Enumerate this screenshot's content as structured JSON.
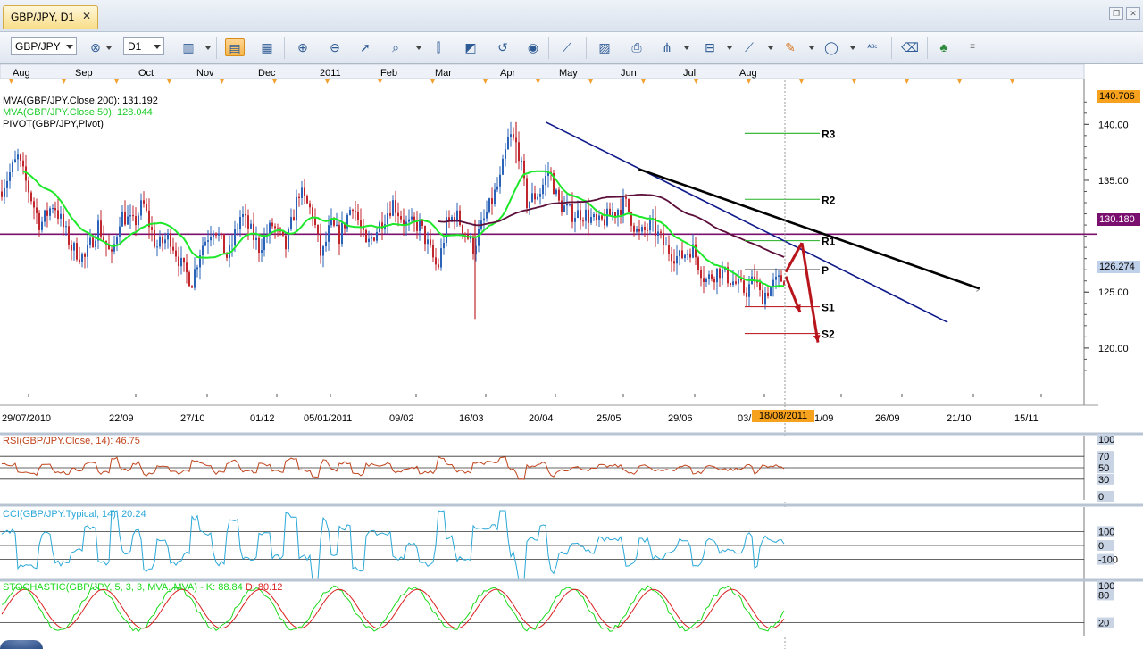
{
  "window": {
    "tab_label": "GBP/JPY, D1",
    "close_glyph": "✕",
    "restore_glyph": "❐",
    "close_window_glyph": "✕"
  },
  "toolbar": {
    "symbol": "GBP/JPY",
    "timeframe": "D1",
    "icons": [
      "crosshair-cursor-icon",
      "candles-icon",
      "bar-chart-icon",
      "line-chart-icon",
      "zoom-in-icon",
      "zoom-out-icon",
      "pointer-icon",
      "zoom-area-icon",
      "vertical-line-icon",
      "shapes-icon",
      "curve-icon",
      "globe-icon",
      "ruler-icon",
      "image-icon",
      "print-icon",
      "fork-icon",
      "channel-icon",
      "trendline-icon",
      "pencil-icon",
      "ellipse-icon",
      "text-abc-icon",
      "eraser-icon",
      "tree-icon"
    ]
  },
  "colors": {
    "up_candle": "#2a63b8",
    "down_candle": "#c0262c",
    "ma50": "#1ee82a",
    "ma200": "#5b0f3a",
    "pivot_line": "#7a0f6f",
    "trendline": "#0f1a8a",
    "rsi": "#c0441c",
    "cci": "#2aa8d8",
    "stoch_k": "#1cd91c",
    "stoch_d": "#d92020",
    "arrow": "#b8141c",
    "price_box": "#f7a21f"
  },
  "chart_data": [
    {
      "type": "candlestick",
      "symbol": "GBP/JPY",
      "timeframe": "D1",
      "month_labels": [
        "Aug",
        "Sep",
        "Oct",
        "Nov",
        "Dec",
        "2011",
        "Feb",
        "Mar",
        "Apr",
        "May",
        "Jun",
        "Jul",
        "Aug"
      ],
      "date_labels": [
        "29/07/2010",
        "22/09",
        "27/10",
        "01/12",
        "05/01/2011",
        "09/02",
        "16/03",
        "20/04",
        "25/05",
        "29/06",
        "03/",
        "1/09",
        "26/09",
        "21/10",
        "15/11"
      ],
      "highlight_date": "18/08/2011",
      "y_ticks": [
        140.0,
        135.0,
        125.0,
        120.0
      ],
      "ylim": [
        116.0,
        142.5
      ],
      "price_labels": [
        {
          "value": 140.706,
          "text": "140.706",
          "color": "#f7a21f"
        },
        {
          "value": 130.18,
          "text": "130.180",
          "color": "#7a0f6f"
        },
        {
          "value": 126.274,
          "text": "126.274",
          "color": "#bfd0ea"
        }
      ],
      "legend": [
        {
          "text": "MVA(GBP/JPY.Close,200): 131.192",
          "color": "#000000"
        },
        {
          "text": "MVA(GBP/JPY.Close,50): 128.044",
          "color": "#1ecc2a"
        },
        {
          "text": "PIVOT(GBP/JPY,Pivot)",
          "color": "#000000"
        }
      ],
      "pivots": [
        {
          "label": "R3",
          "value": 139.2
        },
        {
          "label": "R2",
          "value": 133.3
        },
        {
          "label": "R1",
          "value": 129.6
        },
        {
          "label": "P",
          "value": 127.0
        },
        {
          "label": "S1",
          "value": 123.7
        },
        {
          "label": "S2",
          "value": 121.3
        }
      ],
      "horizontal_line": 130.18,
      "trendlines": [
        {
          "from": [
            "2011-04-07",
            140.2
          ],
          "to": [
            "2011-10-10",
            122.3
          ],
          "color": "#0f1a8a"
        },
        {
          "from": [
            "2011-05-20",
            136.0
          ],
          "to": [
            "2011-10-25",
            125.3
          ],
          "color": "#000000"
        }
      ],
      "arrows": [
        {
          "from": [
            "2011-09-06",
            126.6
          ],
          "to": [
            "2011-09-12",
            120.5
          ]
        },
        {
          "from": [
            "2011-08-22",
            126.4
          ],
          "to": [
            "2011-09-02",
            123.2
          ]
        }
      ]
    },
    {
      "type": "line",
      "name": "RSI(GBP/JPY.Close, 14): 46.75",
      "y_ticks": [
        100,
        70,
        50,
        30,
        0
      ],
      "ylim": [
        0,
        100
      ]
    },
    {
      "type": "line",
      "name": "CCI(GBP/JPY.Typical, 14): 20.24",
      "y_ticks": [
        100,
        0,
        -100
      ],
      "ylim": [
        -250,
        250
      ]
    },
    {
      "type": "line",
      "name": "STOCHASTIC(GBP/JPY, 5, 3, 3, MVA, MVA) - ",
      "k_label": "K: 88.84",
      "d_label": "D: 80.12",
      "y_ticks": [
        100,
        80,
        20
      ],
      "ylim": [
        0,
        100
      ]
    }
  ]
}
